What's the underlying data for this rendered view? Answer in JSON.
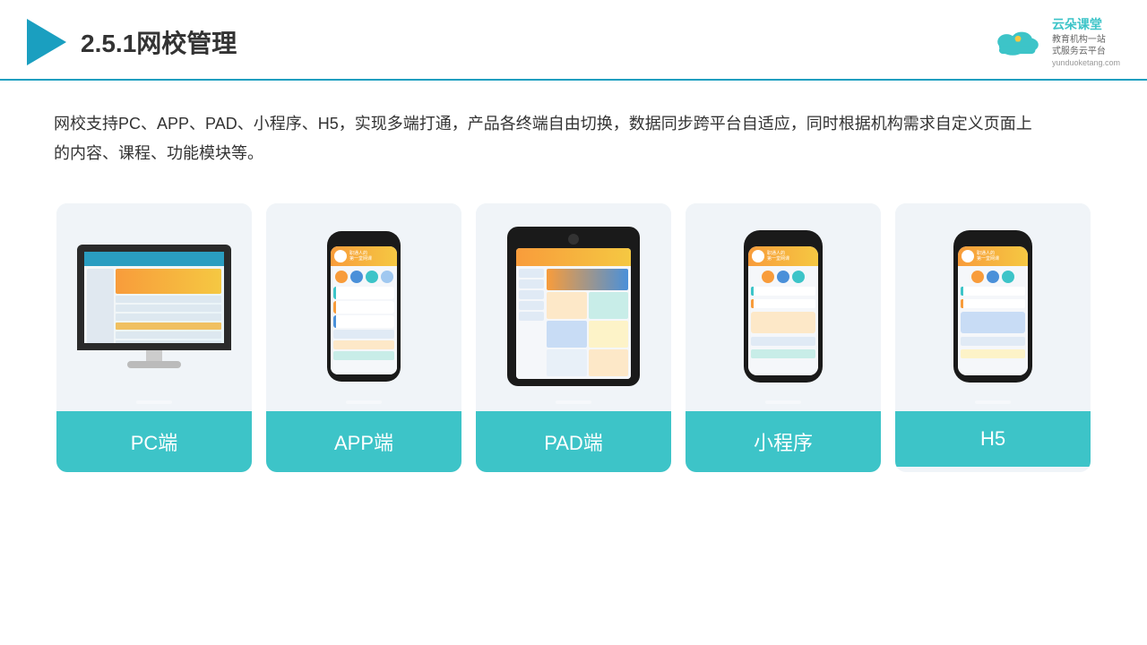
{
  "header": {
    "section_number": "2.5.1",
    "title": "网校管理",
    "logo_name": "云朵课堂",
    "logo_subtitle": "教育机构一站\n式服务云平台",
    "logo_domain": "yunduoketang.com"
  },
  "description": {
    "text": "网校支持PC、APP、PAD、小程序、H5，实现多端打通，产品各终端自由切换，数据同步跨平台自适应，同时根据机构需求自定义页面上的内容、课程、功能模块等。"
  },
  "cards": [
    {
      "id": "pc",
      "label": "PC端"
    },
    {
      "id": "app",
      "label": "APP端"
    },
    {
      "id": "pad",
      "label": "PAD端"
    },
    {
      "id": "miniprogram",
      "label": "小程序"
    },
    {
      "id": "h5",
      "label": "H5"
    }
  ],
  "colors": {
    "accent": "#3dc4c8",
    "header_line": "#1a9fc0",
    "card_bg": "#eef2f7",
    "play_arrow": "#1a9fc0"
  }
}
